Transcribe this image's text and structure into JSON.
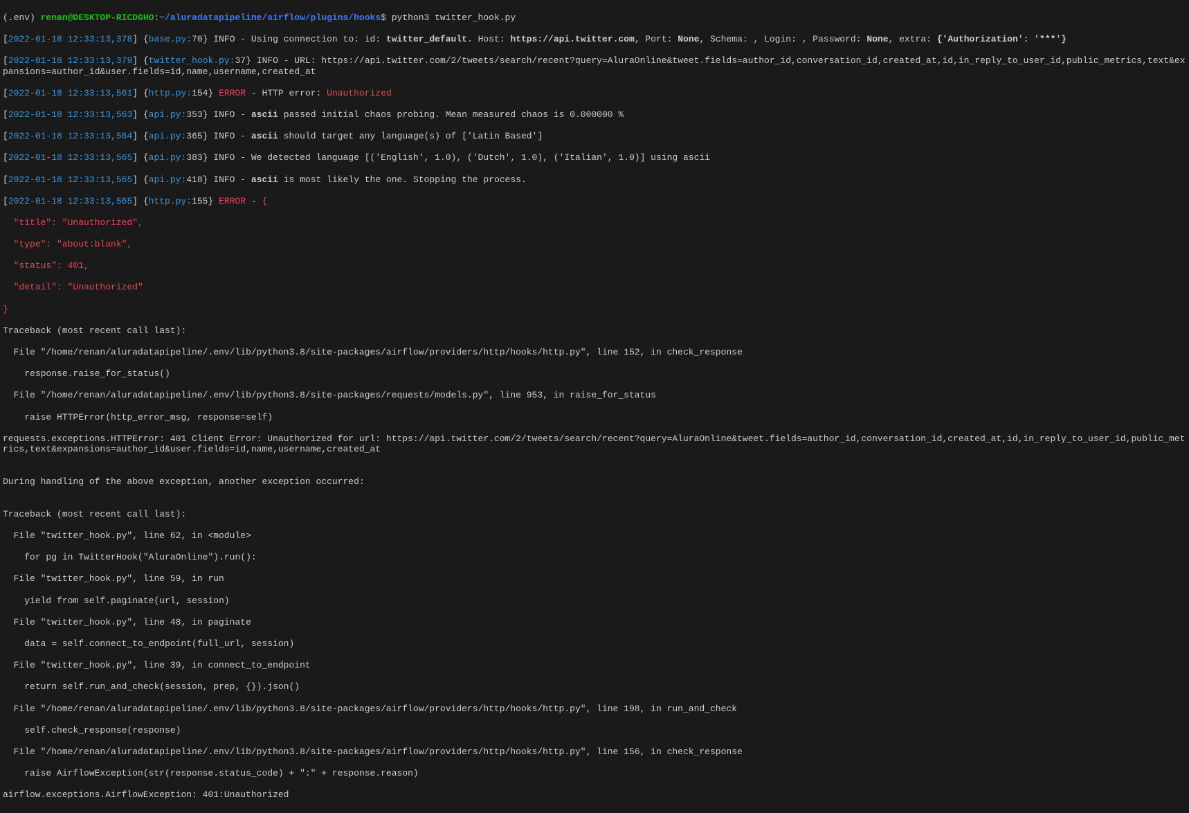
{
  "prompt": {
    "env": "(.env) ",
    "userhost": "renan@DESKTOP-RICDGHO",
    "sep1": ":",
    "path": "~/aluradatapipeline/airflow/plugins/hooks",
    "sep2": "$ ",
    "cmd": "python3 twitter_hook.py"
  },
  "log1": {
    "ts": "2022-01-18 12:33:13,378",
    "src": "base.py:",
    "ln": "70",
    "pre": "} INFO - Using connection to: id: ",
    "id": "twitter_default",
    "mid1": ". Host: ",
    "host": "https://api.twitter.com",
    "mid2": ", Port: ",
    "port": "None",
    "mid3": ", Schema: , Login: , Password: ",
    "pwd": "None",
    "mid4": ", extra: ",
    "extra": "{'Authorization': '***'}"
  },
  "log2": {
    "ts": "2022-01-18 12:33:13,379",
    "src": "twitter_hook.py:",
    "ln": "37",
    "rest": "} INFO - URL: https://api.twitter.com/2/tweets/search/recent?query=AluraOnline&tweet.fields=author_id,conversation_id,created_at,id,in_reply_to_user_id,public_metrics,text&expansions=author_id&user.fields=id,name,username,created_at"
  },
  "log3": {
    "ts": "2022-01-18 12:33:13,561",
    "src": "http.py:",
    "ln": "154",
    "close": "} ",
    "err": "ERROR",
    "dash": " - ",
    "msg1": "HTTP error: ",
    "msg2": "Unauthorized"
  },
  "log4": {
    "ts": "2022-01-18 12:33:13,563",
    "src": "api.py:",
    "ln": "353",
    "pre": "} INFO - ",
    "kw": "ascii",
    "rest": " passed initial chaos probing. Mean measured chaos is 0.000000 %"
  },
  "log5": {
    "ts": "2022-01-18 12:33:13,564",
    "src": "api.py:",
    "ln": "365",
    "pre": "} INFO - ",
    "kw": "ascii",
    "rest": " should target any language(s) of ['Latin Based']"
  },
  "log6": {
    "ts": "2022-01-18 12:33:13,565",
    "src": "api.py:",
    "ln": "383",
    "rest": "} INFO - We detected language [('English', 1.0), ('Dutch', 1.0), ('Italian', 1.0)] using ascii"
  },
  "log7": {
    "ts": "2022-01-18 12:33:13,565",
    "src": "api.py:",
    "ln": "418",
    "pre": "} INFO - ",
    "kw": "ascii",
    "rest": " is most likely the one. Stopping the process."
  },
  "log8": {
    "ts": "2022-01-18 12:33:13,565",
    "src": "http.py:",
    "ln": "155",
    "close": "} ",
    "err": "ERROR",
    "dash": " - ",
    "brace": "{"
  },
  "json": {
    "l1": "  \"title\": \"Unauthorized\",",
    "l2": "  \"type\": \"about:blank\",",
    "l3": "  \"status\": 401,",
    "l4": "  \"detail\": \"Unauthorized\"",
    "l5": "}"
  },
  "tb1": {
    "l1": "Traceback (most recent call last):",
    "l2": "  File \"/home/renan/aluradatapipeline/.env/lib/python3.8/site-packages/airflow/providers/http/hooks/http.py\", line 152, in check_response",
    "l3": "    response.raise_for_status()",
    "l4": "  File \"/home/renan/aluradatapipeline/.env/lib/python3.8/site-packages/requests/models.py\", line 953, in raise_for_status",
    "l5": "    raise HTTPError(http_error_msg, response=self)",
    "l6": "requests.exceptions.HTTPError: 401 Client Error: Unauthorized for url: https://api.twitter.com/2/tweets/search/recent?query=AluraOnline&tweet.fields=author_id,conversation_id,created_at,id,in_reply_to_user_id,public_metrics,text&expansions=author_id&user.fields=id,name,username,created_at"
  },
  "mid": {
    "blank": "",
    "msg": "During handling of the above exception, another exception occurred:"
  },
  "tb2": {
    "l1": "Traceback (most recent call last):",
    "l2": "  File \"twitter_hook.py\", line 62, in <module>",
    "l3": "    for pg in TwitterHook(\"AluraOnline\").run():",
    "l4": "  File \"twitter_hook.py\", line 59, in run",
    "l5": "    yield from self.paginate(url, session)",
    "l6": "  File \"twitter_hook.py\", line 48, in paginate",
    "l7": "    data = self.connect_to_endpoint(full_url, session)",
    "l8": "  File \"twitter_hook.py\", line 39, in connect_to_endpoint",
    "l9": "    return self.run_and_check(session, prep, {}).json()",
    "l10": "  File \"/home/renan/aluradatapipeline/.env/lib/python3.8/site-packages/airflow/providers/http/hooks/http.py\", line 198, in run_and_check",
    "l11": "    self.check_response(response)",
    "l12": "  File \"/home/renan/aluradatapipeline/.env/lib/python3.8/site-packages/airflow/providers/http/hooks/http.py\", line 156, in check_response",
    "l13": "    raise AirflowException(str(response.status_code) + \":\" + response.reason)",
    "l14": "airflow.exceptions.AirflowException: 401:Unauthorized"
  }
}
